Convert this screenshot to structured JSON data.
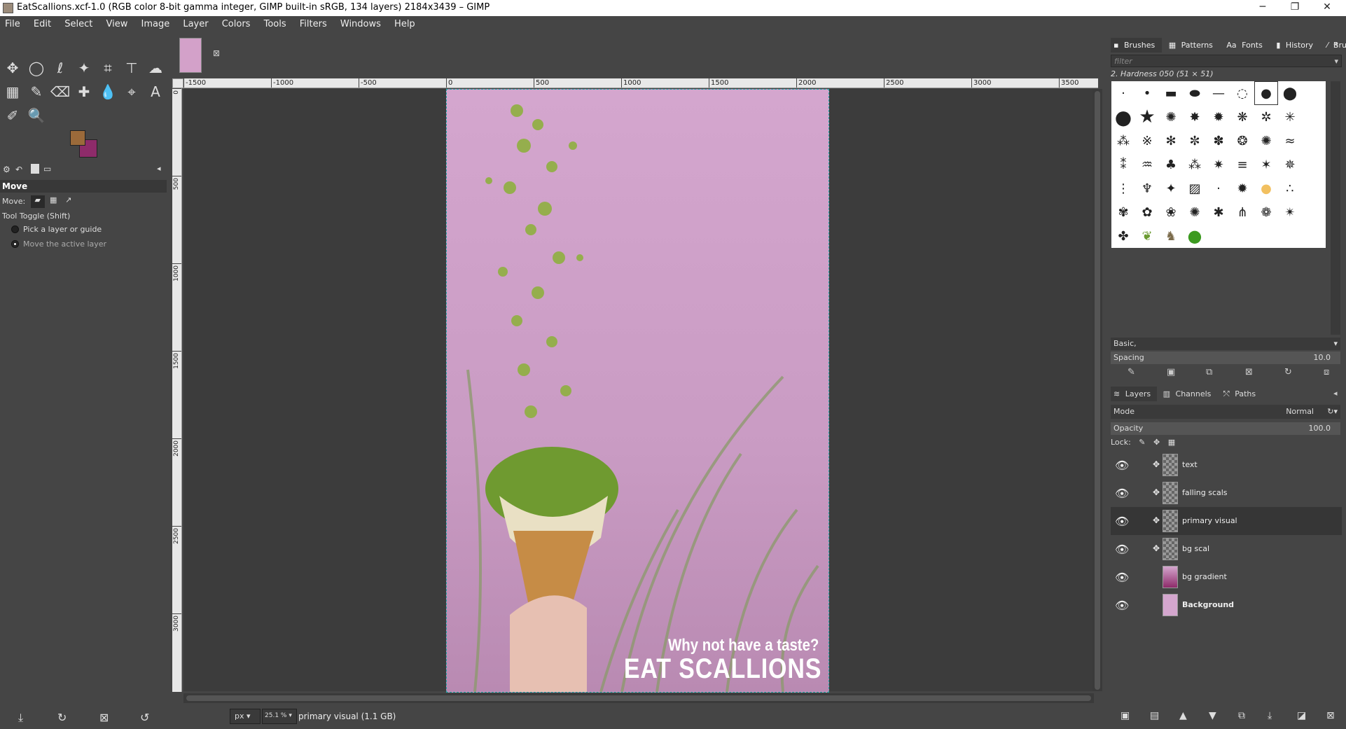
{
  "window": {
    "title": "EatScallions.xcf-1.0 (RGB color 8-bit gamma integer, GIMP built-in sRGB, 134 layers) 2184x3439 – GIMP",
    "minimize": "─",
    "maximize": "❐",
    "close": "✕"
  },
  "menu": [
    "File",
    "Edit",
    "Select",
    "View",
    "Image",
    "Layer",
    "Colors",
    "Tools",
    "Filters",
    "Windows",
    "Help"
  ],
  "colors": {
    "foreground": "#9b6a3a",
    "background": "#8e2b6a",
    "canvas_bg": "#d4a6ce"
  },
  "tool_options": {
    "title": "Move",
    "move_label": "Move:",
    "tool_toggle": "Tool Toggle  (Shift)",
    "option1": "Pick a layer or guide",
    "option2": "Move the active layer"
  },
  "ruler_h": [
    "-1500",
    "-1000",
    "-500",
    "0",
    "500",
    "1000",
    "1500",
    "2000",
    "2500",
    "3000",
    "3500"
  ],
  "ruler_v": [
    "0",
    "500",
    "1000",
    "1500",
    "2000",
    "2500",
    "3000"
  ],
  "image_text": {
    "line1": "Why not have a taste?",
    "line2": "EAT SCALLIONS"
  },
  "status": {
    "unit": "px",
    "zoom": "25.1 %",
    "text": "primary visual (1.1 GB)"
  },
  "brushes": {
    "tabs": [
      "Brushes",
      "Patterns",
      "Fonts",
      "History",
      "Brush Editor"
    ],
    "filter_placeholder": "filter",
    "selected_name": "2. Hardness 050 (51 × 51)",
    "preset": "Basic,",
    "spacing_label": "Spacing",
    "spacing_value": "10.0"
  },
  "layers": {
    "tabs": [
      "Layers",
      "Channels",
      "Paths"
    ],
    "mode_label": "Mode",
    "mode_value": "Normal",
    "opacity_label": "Opacity",
    "opacity_value": "100.0",
    "lock_label": "Lock:",
    "items": [
      {
        "name": "text",
        "selected": false
      },
      {
        "name": "falling scals",
        "selected": false
      },
      {
        "name": "primary visual",
        "selected": true
      },
      {
        "name": "bg scal",
        "selected": false
      },
      {
        "name": "bg gradient",
        "selected": false
      },
      {
        "name": "Background",
        "selected": false
      }
    ]
  }
}
